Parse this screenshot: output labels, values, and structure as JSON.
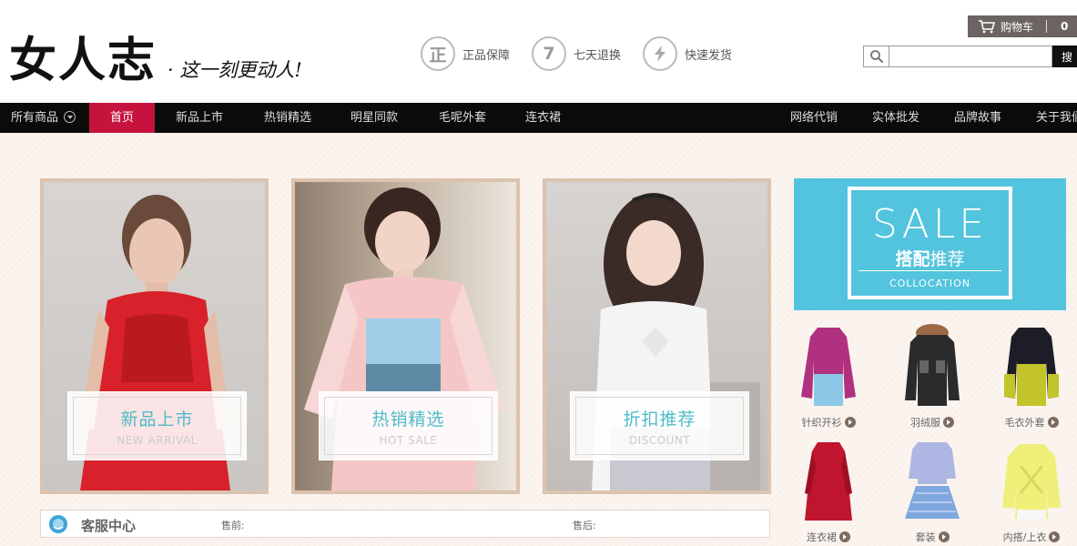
{
  "header": {
    "logo": "女人志",
    "slogan": "· 这一刻更动人!",
    "features": [
      {
        "icon": "正",
        "label": "正品保障"
      },
      {
        "icon": "7",
        "label": "七天退换"
      },
      {
        "icon": "lightning-icon",
        "label": "快速发货"
      }
    ],
    "cart": {
      "label": "购物车",
      "count": "0"
    },
    "search": {
      "placeholder": "",
      "button": "搜"
    }
  },
  "nav": {
    "all_products": "所有商品",
    "items": [
      "首页",
      "新品上市",
      "热销精选",
      "明星同款",
      "毛呢外套",
      "连衣裙"
    ],
    "right_items": [
      "网络代销",
      "实体批发",
      "品牌故事",
      "关于我们"
    ]
  },
  "cards": [
    {
      "title": "新品上市",
      "subtitle": "NEW ARRIVAL"
    },
    {
      "title": "热销精选",
      "subtitle": "HOT SALE"
    },
    {
      "title": "折扣推荐",
      "subtitle": "DISCOUNT"
    }
  ],
  "service": {
    "title": "客服中心",
    "pre_sale": "售前:",
    "post_sale": "售后:"
  },
  "sale_banner": {
    "big": "SALE",
    "title_bold": "搭配",
    "title_rest": "推荐",
    "sub": "COLLOCATION"
  },
  "products": [
    "针织开衫",
    "羽绒服",
    "毛衣外套",
    "连衣裙",
    "套装",
    "内搭/上衣"
  ],
  "colors": {
    "accent": "#c6133d",
    "nav_bg": "#0b0b0b",
    "teal": "#4fbbc9",
    "sale_bg": "#53c4dd"
  }
}
